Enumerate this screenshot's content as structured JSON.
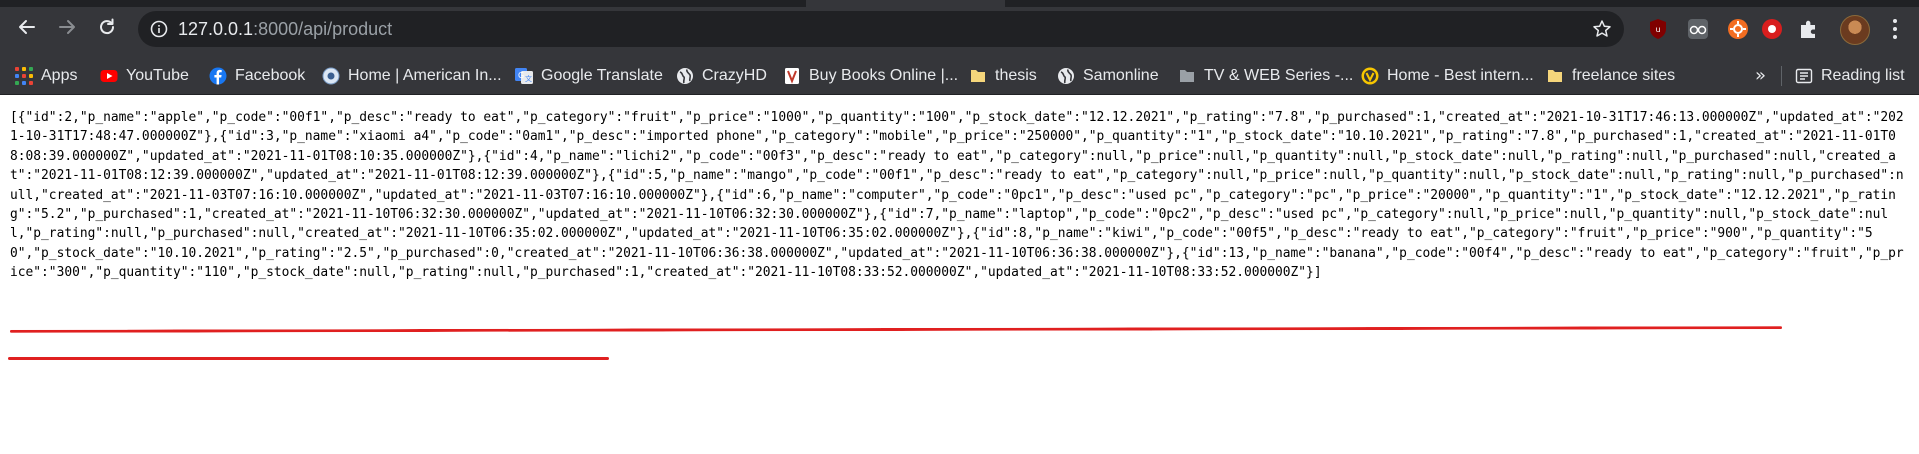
{
  "browser": {
    "url_host": "127.0.0.1",
    "url_rest": ":8000/api/product",
    "icons": {
      "back": "arrow-left-icon",
      "forward": "arrow-right-icon",
      "reload": "reload-icon",
      "site_info": "info-icon",
      "bookmark_star": "star-icon",
      "extensions": [
        "ublock-icon",
        "eyeglasses-icon",
        "gear-orange-icon",
        "red-record-icon",
        "puzzle-piece-icon"
      ],
      "menu": "kebab-menu-icon"
    },
    "colors": {
      "toolbar": "#35363a",
      "omnibox": "#202124",
      "text": "#e8eaed",
      "annotation": "#e02020"
    }
  },
  "bookmarks": {
    "items": [
      {
        "label": "Apps",
        "icon": "apps-grid-icon"
      },
      {
        "label": "YouTube",
        "icon": "youtube-icon"
      },
      {
        "label": "Facebook",
        "icon": "facebook-icon"
      },
      {
        "label": "Home | American In...",
        "icon": "globe-badge-icon"
      },
      {
        "label": "Google Translate",
        "icon": "google-translate-icon"
      },
      {
        "label": "CrazyHD",
        "icon": "globe-icon"
      },
      {
        "label": "Buy Books Online |...",
        "icon": "book-icon"
      },
      {
        "label": "thesis",
        "icon": "folder-icon"
      },
      {
        "label": "Samonline",
        "icon": "globe-icon"
      },
      {
        "label": "TV & WEB Series -...",
        "icon": "folder-icon"
      },
      {
        "label": "Home - Best intern...",
        "icon": "yellow-v-icon"
      },
      {
        "label": "freelance sites",
        "icon": "folder-icon"
      }
    ],
    "more_chevron": "»",
    "reading_list_label": "Reading list"
  },
  "page": {
    "json_text": "[{\"id\":2,\"p_name\":\"apple\",\"p_code\":\"00f1\",\"p_desc\":\"ready to eat\",\"p_category\":\"fruit\",\"p_price\":\"1000\",\"p_quantity\":\"100\",\"p_stock_date\":\"12.12.2021\",\"p_rating\":\"7.8\",\"p_purchased\":1,\"created_at\":\"2021-10-31T17:46:13.000000Z\",\"updated_at\":\"2021-10-31T17:48:47.000000Z\"},{\"id\":3,\"p_name\":\"xiaomi a4\",\"p_code\":\"0am1\",\"p_desc\":\"imported phone\",\"p_category\":\"mobile\",\"p_price\":\"250000\",\"p_quantity\":\"1\",\"p_stock_date\":\"10.10.2021\",\"p_rating\":\"7.8\",\"p_purchased\":1,\"created_at\":\"2021-11-01T08:08:39.000000Z\",\"updated_at\":\"2021-11-01T08:10:35.000000Z\"},{\"id\":4,\"p_name\":\"lichi2\",\"p_code\":\"00f3\",\"p_desc\":\"ready to eat\",\"p_category\":null,\"p_price\":null,\"p_quantity\":null,\"p_stock_date\":null,\"p_rating\":null,\"p_purchased\":null,\"created_at\":\"2021-11-01T08:12:39.000000Z\",\"updated_at\":\"2021-11-01T08:12:39.000000Z\"},{\"id\":5,\"p_name\":\"mango\",\"p_code\":\"00f1\",\"p_desc\":\"ready to eat\",\"p_category\":null,\"p_price\":null,\"p_quantity\":null,\"p_stock_date\":null,\"p_rating\":null,\"p_purchased\":null,\"created_at\":\"2021-11-03T07:16:10.000000Z\",\"updated_at\":\"2021-11-03T07:16:10.000000Z\"},{\"id\":6,\"p_name\":\"computer\",\"p_code\":\"0pc1\",\"p_desc\":\"used pc\",\"p_category\":\"pc\",\"p_price\":\"20000\",\"p_quantity\":\"1\",\"p_stock_date\":\"12.12.2021\",\"p_rating\":\"5.2\",\"p_purchased\":1,\"created_at\":\"2021-11-10T06:32:30.000000Z\",\"updated_at\":\"2021-11-10T06:32:30.000000Z\"},{\"id\":7,\"p_name\":\"laptop\",\"p_code\":\"0pc2\",\"p_desc\":\"used pc\",\"p_category\":null,\"p_price\":null,\"p_quantity\":null,\"p_stock_date\":null,\"p_rating\":null,\"p_purchased\":null,\"created_at\":\"2021-11-10T06:35:02.000000Z\",\"updated_at\":\"2021-11-10T06:35:02.000000Z\"},{\"id\":8,\"p_name\":\"kiwi\",\"p_code\":\"00f5\",\"p_desc\":\"ready to eat\",\"p_category\":\"fruit\",\"p_price\":\"900\",\"p_quantity\":\"50\",\"p_stock_date\":\"10.10.2021\",\"p_rating\":\"2.5\",\"p_purchased\":0,\"created_at\":\"2021-11-10T06:36:38.000000Z\",\"updated_at\":\"2021-11-10T06:36:38.000000Z\"},{\"id\":13,\"p_name\":\"banana\",\"p_code\":\"00f4\",\"p_desc\":\"ready to eat\",\"p_category\":\"fruit\",\"p_price\":\"300\",\"p_quantity\":\"110\",\"p_stock_date\":null,\"p_rating\":null,\"p_purchased\":1,\"created_at\":\"2021-11-10T08:33:52.000000Z\",\"updated_at\":\"2021-11-10T08:33:52.000000Z\"}]"
  }
}
